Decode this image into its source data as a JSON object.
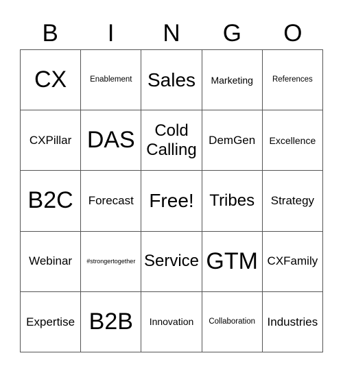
{
  "header": [
    "B",
    "I",
    "N",
    "G",
    "O"
  ],
  "cells": [
    [
      "CX",
      "Enablement",
      "Sales",
      "Marketing",
      "References"
    ],
    [
      "CXPillar",
      "DAS",
      "Cold Calling",
      "DemGen",
      "Excellence"
    ],
    [
      "B2C",
      "Forecast",
      "Free!",
      "Tribes",
      "Strategy"
    ],
    [
      "Webinar",
      "#strongertogether",
      "Service",
      "GTM",
      "CXFamily"
    ],
    [
      "Expertise",
      "B2B",
      "Innovation",
      "Collaboration",
      "Industries"
    ]
  ]
}
